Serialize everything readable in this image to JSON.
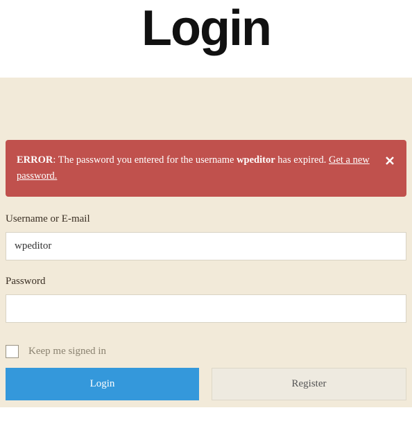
{
  "page": {
    "title": "Login"
  },
  "error": {
    "prefix": "ERROR",
    "text_before": ": The password you entered for the username ",
    "username": "wpeditor",
    "text_after": " has expired. ",
    "link_text": "Get a new password."
  },
  "fields": {
    "username": {
      "label": "Username or E-mail",
      "value": "wpeditor"
    },
    "password": {
      "label": "Password",
      "value": ""
    }
  },
  "checkbox": {
    "label": "Keep me signed in"
  },
  "buttons": {
    "login": "Login",
    "register": "Register"
  }
}
